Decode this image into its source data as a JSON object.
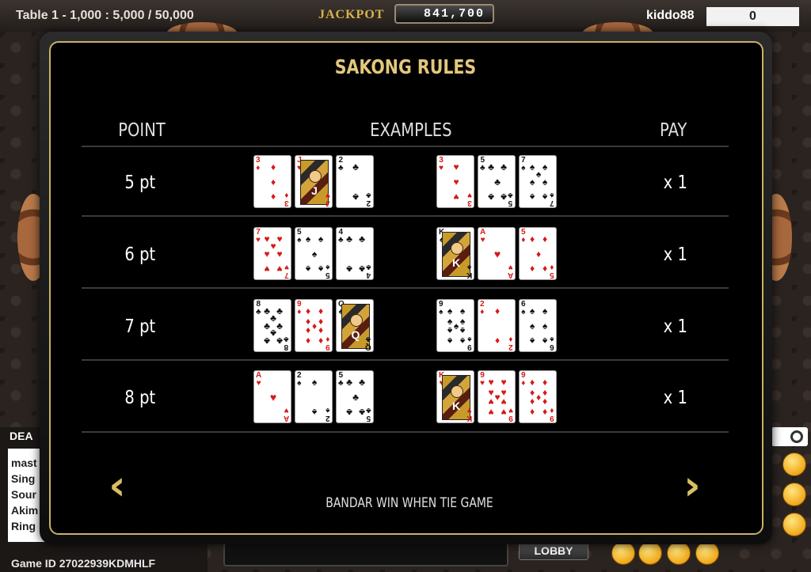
{
  "header": {
    "table_info": "Table 1 - 1,000 : 5,000 / 50,000",
    "jackpot_label": "JACKPOT",
    "jackpot_value": "841,700",
    "username": "kiddo88",
    "balance": "0"
  },
  "background": {
    "chat_title": "DEA",
    "chat_lines": [
      "mast",
      "Sing",
      "Sour",
      "Akim",
      "Ring"
    ],
    "game_id": "Game ID 27022939KDMHLF",
    "lobby_label": "LOBBY"
  },
  "modal": {
    "title": "SAKONG RULES",
    "columns": {
      "point": "POINT",
      "examples": "EXAMPLES",
      "pay": "PAY"
    },
    "footer_note": "BANDAR WIN WHEN TIE GAME",
    "prev_icon": "chevron-left-icon",
    "next_icon": "chevron-right-icon",
    "rows": [
      {
        "point": "5 pt",
        "pay": "x 1",
        "examples": [
          [
            {
              "rank": "3",
              "suit": "diamonds"
            },
            {
              "rank": "J",
              "suit": "hearts"
            },
            {
              "rank": "2",
              "suit": "clubs"
            }
          ],
          [
            {
              "rank": "3",
              "suit": "hearts"
            },
            {
              "rank": "5",
              "suit": "clubs"
            },
            {
              "rank": "7",
              "suit": "spades"
            }
          ]
        ]
      },
      {
        "point": "6 pt",
        "pay": "x 1",
        "examples": [
          [
            {
              "rank": "7",
              "suit": "hearts"
            },
            {
              "rank": "5",
              "suit": "spades"
            },
            {
              "rank": "4",
              "suit": "clubs"
            }
          ],
          [
            {
              "rank": "K",
              "suit": "spades"
            },
            {
              "rank": "A",
              "suit": "hearts"
            },
            {
              "rank": "5",
              "suit": "diamonds"
            }
          ]
        ]
      },
      {
        "point": "7 pt",
        "pay": "x 1",
        "examples": [
          [
            {
              "rank": "8",
              "suit": "clubs"
            },
            {
              "rank": "9",
              "suit": "diamonds"
            },
            {
              "rank": "Q",
              "suit": "clubs"
            }
          ],
          [
            {
              "rank": "9",
              "suit": "spades"
            },
            {
              "rank": "2",
              "suit": "diamonds"
            },
            {
              "rank": "6",
              "suit": "spades"
            }
          ]
        ]
      },
      {
        "point": "8 pt",
        "pay": "x 1",
        "examples": [
          [
            {
              "rank": "A",
              "suit": "hearts"
            },
            {
              "rank": "2",
              "suit": "spades"
            },
            {
              "rank": "5",
              "suit": "clubs"
            }
          ],
          [
            {
              "rank": "K",
              "suit": "hearts"
            },
            {
              "rank": "9",
              "suit": "hearts"
            },
            {
              "rank": "9",
              "suit": "diamonds"
            }
          ]
        ]
      }
    ]
  },
  "colors": {
    "gold_title": "#e4c77d",
    "modal_border": "#c9b06b",
    "arrow_gold": "#d9bf63",
    "card_red": "#d41a1a"
  }
}
